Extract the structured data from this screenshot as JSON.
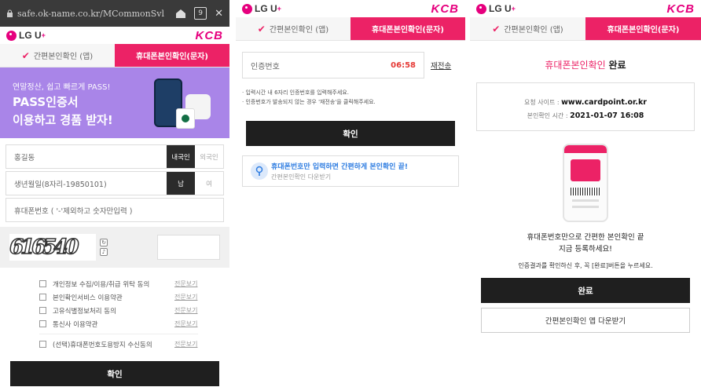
{
  "browser": {
    "url": "safe.ok-name.co.kr/MCommonSvl",
    "tab_count": "9"
  },
  "brand": {
    "lgu": "LG U",
    "lgu_plus": "+",
    "kcb": "KCB"
  },
  "tabs": {
    "app": "간편본인확인 (앱)",
    "sms": "휴대폰본인확인(문자)"
  },
  "panel1": {
    "banner_small": "연말정산, 쉽고 빠르게 PASS!",
    "banner_line1": "PASS인증서",
    "banner_line2": "이용하고 경품 받자!",
    "name_value": "홍길동",
    "nationality_domestic": "내국인",
    "nationality_foreign": "외국인",
    "birth_placeholder": "생년월일(8자리-19850101)",
    "gender_male": "남",
    "gender_female": "여",
    "phone_placeholder": "휴대폰번호 ( '-'제외하고 숫자만입력 )",
    "captcha_text": "616540",
    "agreements": [
      {
        "label": "개인정보 수집/이용/취급 위탁 동의",
        "more": "전문보기"
      },
      {
        "label": "본인확인서비스 이용약관",
        "more": "전문보기"
      },
      {
        "label": "고유식별정보처리 동의",
        "more": "전문보기"
      },
      {
        "label": "통신사 이용약관",
        "more": "전문보기"
      }
    ],
    "optional_agreement": {
      "label": "(선택)휴대폰번호도용방지 수신동의",
      "more": "전문보기"
    },
    "confirm": "확인"
  },
  "panel2": {
    "code_placeholder": "인증번호",
    "timer": "06:58",
    "resend": "재전송",
    "note1": "· 입력시간 내 6자리 인증번호를 입력해주세요.",
    "note2": "· 인증번호가 발송되지 않는 경우 '재전송'을 클릭해주세요.",
    "confirm": "확인",
    "promo_title": "휴대폰번호만 입력하면 간편하게 본인확인 끝!",
    "promo_sub": "간편본인확인 다운받기"
  },
  "panel3": {
    "title_prefix": "휴대폰본인확인",
    "title_done": "완료",
    "site_label": "요청 사이트 : ",
    "site_value": "www.cardpoint.or.kr",
    "time_label": "본인확인 시간 : ",
    "time_value": "2021-01-07 16:08",
    "msg_line1": "휴대폰번호만으로 간편한 본인확인 끝",
    "msg_line2": "지금 등록하세요!",
    "msg_small": "인증결과를 확인하신 후, 꼭 [완료]버튼을 누르세요.",
    "done": "완료",
    "download": "간편본인확인 앱 다운받기"
  },
  "colors": {
    "accent": "#ec2266",
    "dark": "#1f1f1f",
    "banner": "#a985e8",
    "link_blue": "#2f7de1"
  }
}
